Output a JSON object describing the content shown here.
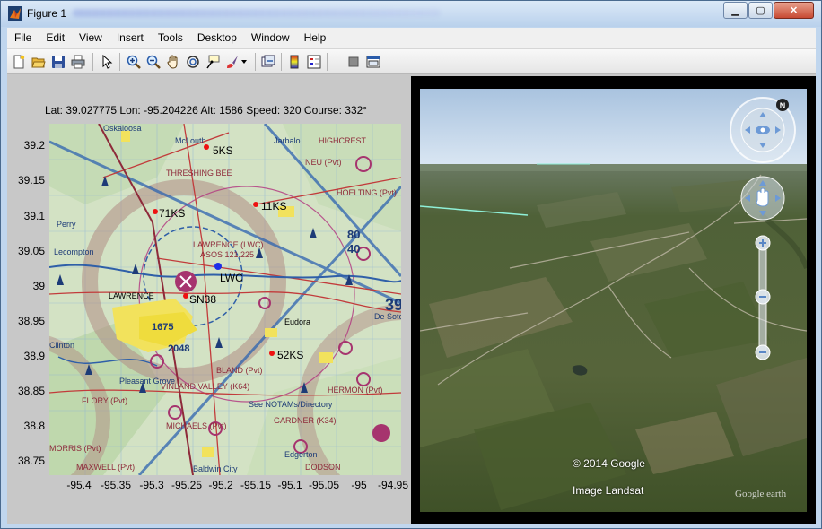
{
  "window": {
    "title": "Figure 1",
    "minimize_glyph": "▁",
    "maximize_glyph": "▢",
    "close_glyph": "✕"
  },
  "menu": {
    "items": [
      "File",
      "Edit",
      "View",
      "Insert",
      "Tools",
      "Desktop",
      "Window",
      "Help"
    ]
  },
  "toolbar": {
    "buttons": [
      "new-figure-icon",
      "open-file-icon",
      "save-icon",
      "print-icon",
      "pointer-icon",
      "zoom-in-icon",
      "zoom-out-icon",
      "pan-hand-icon",
      "rotate-3d-icon",
      "data-cursor-icon",
      "brush-icon",
      "dropdown-arrow-icon",
      "link-plot-icon",
      "colorbar-icon",
      "legend-icon",
      "hide-plot-tools-icon",
      "show-plot-tools-icon"
    ]
  },
  "status": {
    "text": "Lat:  39.027775 Lon: -95.204226 Alt:  1586 Speed: 320 Course: 332°"
  },
  "axes": {
    "yticks": [
      "39.2",
      "39.15",
      "39.1",
      "39.05",
      "39",
      "38.95",
      "38.9",
      "38.85",
      "38.8",
      "38.75"
    ],
    "xticks": [
      "-95.4",
      "-95.35",
      "-95.3",
      "-95.25",
      "-95.2",
      "-95.15",
      "-95.1",
      "-95.05",
      "-95",
      "-94.95"
    ]
  },
  "map_labels": {
    "oskaloosa": "Oskaloosa",
    "mclouth": "McLouth",
    "jarbalo": "Jarbalo",
    "highcrest": "HIGHCREST",
    "threshing_bee": "THRESHING BEE",
    "neu": "NEU (Pvt)",
    "hoelting": "HOELTING (Pvt)",
    "k5ks": "5KS",
    "k71ks": "71KS",
    "k11ks": "11KS",
    "lawrence_tower": "LAWRENCE (LWC)",
    "asos": "ASOS 121.225",
    "lawrence_city": "LAWRENCE",
    "lwc": "LWC",
    "sn38": "SN38",
    "perry": "Perry",
    "lecompton": "Lecompton",
    "eudora": "Eudora",
    "do_soto": "De Soto",
    "bland": "BLAND (Pvt)",
    "pleasant_grove": "Pleasant Grove",
    "vinland": "VINLAND VALLEY (K64)",
    "flory": "FLORY (Pvt)",
    "michaels": "MICHAELS (Pvt)",
    "gardner": "GARDNER (K34)",
    "hermon": "HERMON (Pvt)",
    "see_notams": "See NOTAMs/Directory",
    "edgerton": "Edgerton",
    "baldwin": "Baldwin City",
    "morris": "MORRIS (Pvt)",
    "maxwell": "MAXWELL (Pvt)",
    "clinton": "Clinton",
    "num_80": "80",
    "num_40": "40",
    "num_39": "39",
    "k52ks": "52KS",
    "num_1675": "1675",
    "num_2048": "2048",
    "dodson": "DODSON"
  },
  "google_earth": {
    "copyright": "© 2014 Google",
    "imagery": "Image Landsat",
    "logo": "Google earth",
    "nav_north": "N"
  },
  "colors": {
    "title_bar": "#c4d8ef",
    "figure_bg": "#c8c8c8",
    "earth_frame": "#000000",
    "sky": "#c9dcf2",
    "terrain": "#4f5e3a"
  }
}
